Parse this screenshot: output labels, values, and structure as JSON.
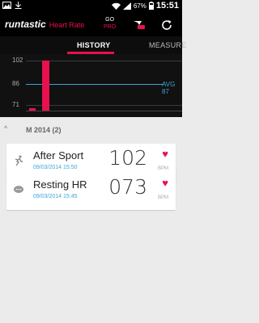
{
  "status": {
    "battery_pct": "67%",
    "time": "15:51"
  },
  "app": {
    "brand_name": "runtastic",
    "brand_sub": "Heart Rate",
    "gopro_top": "GO",
    "gopro_bottom": "PRO"
  },
  "tabs": [
    {
      "label": "HISTORY"
    },
    {
      "label": "MEASURE"
    }
  ],
  "chart_data": {
    "type": "bar",
    "y_ticks": [
      "102",
      "86",
      "71"
    ],
    "values": [
      71,
      102
    ],
    "average": {
      "label": "AVG",
      "value": "87"
    },
    "bar_color": "#e8114e",
    "avg_color": "#3ba6d6"
  },
  "section": {
    "title": "M 2014 (2)"
  },
  "entries": [
    {
      "title": "After Sport",
      "date": "09/03/2014 15:50",
      "value": "102",
      "unit": "BPM",
      "icon": "runner-icon"
    },
    {
      "title": "Resting HR",
      "date": "09/03/2014 15:45",
      "value": "073",
      "unit": "BPM",
      "icon": "chat-icon"
    }
  ],
  "colors": {
    "accent": "#e8114e",
    "blue": "#3ba6d6"
  }
}
